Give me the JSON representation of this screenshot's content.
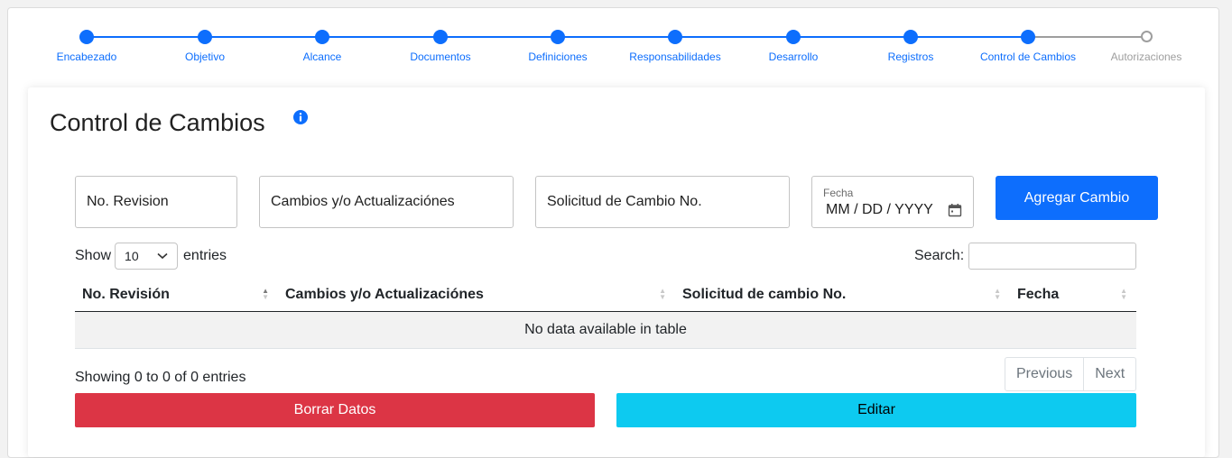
{
  "stepper": {
    "steps": [
      {
        "label": "Encabezado",
        "state": "done"
      },
      {
        "label": "Objetivo",
        "state": "done"
      },
      {
        "label": "Alcance",
        "state": "done"
      },
      {
        "label": "Documentos",
        "state": "done"
      },
      {
        "label": "Definiciones",
        "state": "done"
      },
      {
        "label": "Responsabilidades",
        "state": "done"
      },
      {
        "label": "Desarrollo",
        "state": "done"
      },
      {
        "label": "Registros",
        "state": "done"
      },
      {
        "label": "Control de Cambios",
        "state": "active"
      },
      {
        "label": "Autorizaciones",
        "state": "pending"
      }
    ],
    "accent_color": "#0d6efd",
    "pending_color": "#9e9e9e"
  },
  "card": {
    "title": "Control de Cambios",
    "info_icon": "info-circle-icon"
  },
  "form": {
    "revision_placeholder": "No. Revision",
    "cambios_placeholder": "Cambios y/o Actualizaciónes",
    "solicitud_placeholder": "Solicitud de Cambio No.",
    "fecha_label": "Fecha",
    "fecha_value": "MM / DD / YYYY",
    "add_button": "Agregar Cambio"
  },
  "table_controls": {
    "show_label": "Show",
    "entries_value": "10",
    "entries_label": "entries",
    "search_label": "Search:"
  },
  "table": {
    "columns": [
      "No. Revisión",
      "Cambios y/o Actualizaciónes",
      "Solicitud de cambio No.",
      "Fecha"
    ],
    "empty_message": "No data available in table"
  },
  "footer": {
    "info": "Showing 0 to 0 of 0 entries",
    "previous": "Previous",
    "next": "Next",
    "delete_button": "Borrar Datos",
    "edit_button": "Editar"
  },
  "colors": {
    "primary": "#0d6efd",
    "danger": "#dc3545",
    "info": "#0dcaf0"
  }
}
